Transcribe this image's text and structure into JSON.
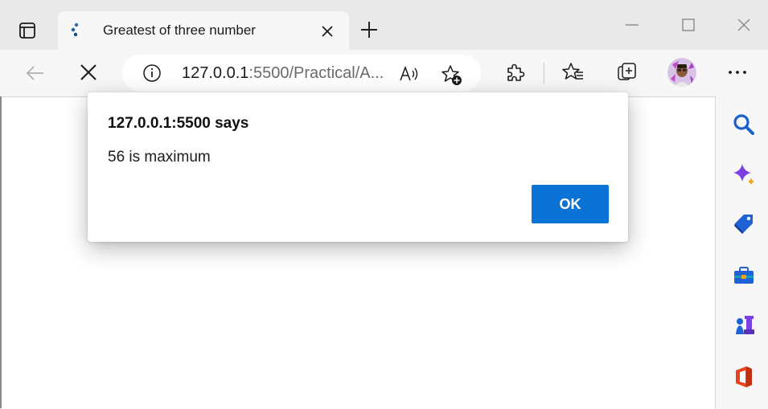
{
  "tab": {
    "title": "Greatest of three number"
  },
  "address_bar": {
    "url_host": "127.0.0.1",
    "url_rest": ":5500/Practical/A..."
  },
  "dialog": {
    "title": "127.0.0.1:5500 says",
    "message": "56 is maximum",
    "ok_label": "OK"
  },
  "toolbar": {
    "icons": [
      "back-icon",
      "stop-icon",
      "info-icon",
      "read-aloud-icon",
      "add-favorite-icon",
      "extensions-icon",
      "favorites-icon",
      "collections-icon",
      "profile-avatar",
      "more-icon"
    ]
  },
  "sidebar": {
    "icons": [
      "search-icon",
      "copilot-icon",
      "shopping-icon",
      "tools-icon",
      "games-icon",
      "office-icon"
    ]
  },
  "colors": {
    "accent": "#0b72d6",
    "tab_strip": "#e9e9e9",
    "toolbar": "#f7f7f7"
  }
}
